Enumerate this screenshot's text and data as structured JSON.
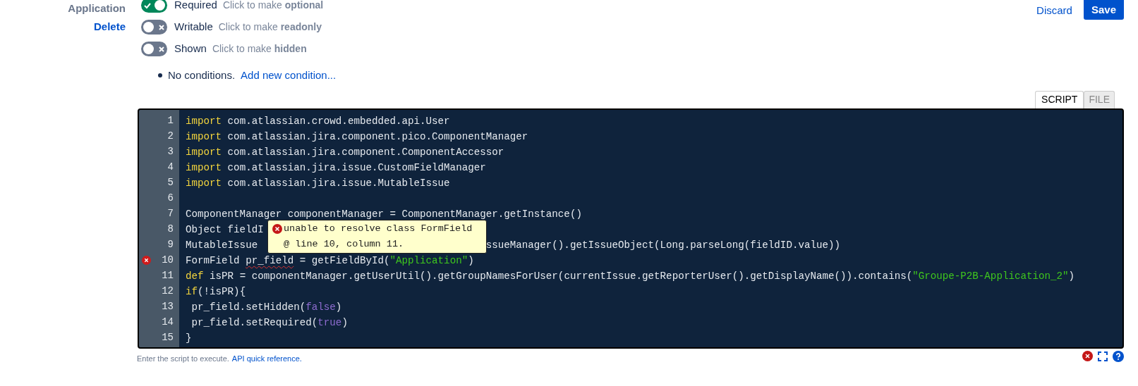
{
  "field": {
    "name": "Application",
    "delete_link": "Delete"
  },
  "toggles": [
    {
      "label": "Required",
      "hint": "Click to make **optional**",
      "on": true
    },
    {
      "label": "Writable",
      "hint": "Click to make **readonly**",
      "on": false
    },
    {
      "label": "Shown",
      "hint": "Click to make **hidden**",
      "on": false
    }
  ],
  "conditions": {
    "text": "No conditions.",
    "link": "Add new condition..."
  },
  "actions": {
    "discard": "Discard",
    "save": "Save"
  },
  "tabs": [
    {
      "label": "SCRIPT",
      "selected": true
    },
    {
      "label": "FILE",
      "selected": false
    }
  ],
  "editor": {
    "lines": [
      {
        "number": "1",
        "error": false,
        "fragments": [
          [
            {
              "kind": "keyword",
              "text": "import"
            },
            {
              "kind": "plain",
              "text": " com.atlassian.crowd.embedded.api.User"
            }
          ]
        ]
      },
      {
        "number": "2",
        "error": false,
        "fragments": [
          [
            {
              "kind": "keyword",
              "text": "import"
            },
            {
              "kind": "plain",
              "text": " com.atlassian.jira.component.pico.ComponentManager"
            }
          ]
        ]
      },
      {
        "number": "3",
        "error": false,
        "fragments": [
          [
            {
              "kind": "keyword",
              "text": "import"
            },
            {
              "kind": "plain",
              "text": " com.atlassian.jira.component.ComponentAccessor"
            }
          ]
        ]
      },
      {
        "number": "4",
        "error": false,
        "fragments": [
          [
            {
              "kind": "keyword",
              "text": "import"
            },
            {
              "kind": "plain",
              "text": " com.atlassian.jira.issue.CustomFieldManager"
            }
          ]
        ]
      },
      {
        "number": "5",
        "error": false,
        "fragments": [
          [
            {
              "kind": "keyword",
              "text": "import"
            },
            {
              "kind": "plain",
              "text": " com.atlassian.jira.issue.MutableIssue"
            }
          ]
        ]
      },
      {
        "number": "6",
        "error": false
      },
      {
        "number": "7",
        "error": false,
        "fragments": [
          [
            {
              "kind": "plain",
              "text": "ComponentManager componentManager = ComponentManager.getInstance()"
            }
          ]
        ]
      },
      {
        "number": "8",
        "error": false,
        "fragments": [
          [
            {
              "kind": "plain",
              "text": "Object fieldI"
            }
          ]
        ]
      },
      {
        "number": "9",
        "error": false,
        "fragments": [
          [
            {
              "kind": "plain",
              "text": "MutableIssue"
            }
          ],
          [
            {
              "kind": "plain",
              "text": "ssueManager().getIssueObject(Long.parseLong(fieldID.value))"
            }
          ]
        ]
      },
      {
        "number": "10",
        "error": true,
        "fragments": [
          [
            {
              "kind": "plain",
              "text": "FormField "
            },
            {
              "kind": "error",
              "text": "pr_field"
            },
            {
              "kind": "plain",
              "text": " = getFieldById("
            },
            {
              "kind": "string",
              "text": "\"Application\""
            },
            {
              "kind": "plain",
              "text": ")"
            }
          ]
        ]
      },
      {
        "number": "11",
        "error": false,
        "fragments": [
          [
            {
              "kind": "keyword",
              "text": "def"
            },
            {
              "kind": "plain",
              "text": " isPR = componentManager.getUserUtil().getGroupNamesForUser(currentIssue.getReporterUser().getDisplayName()).contains("
            },
            {
              "kind": "string",
              "text": "\"Groupe-P2B-Application_2\""
            },
            {
              "kind": "plain",
              "text": ")"
            }
          ]
        ]
      },
      {
        "number": "12",
        "error": false,
        "fragments": [
          [
            {
              "kind": "keyword",
              "text": "if"
            },
            {
              "kind": "plain",
              "text": "(!isPR){"
            }
          ]
        ]
      },
      {
        "number": "13",
        "error": false,
        "fragments": [
          [
            {
              "kind": "plain",
              "text": " pr_field.setHidden("
            },
            {
              "kind": "literal",
              "text": "false"
            },
            {
              "kind": "plain",
              "text": ")"
            }
          ]
        ]
      },
      {
        "number": "14",
        "error": false,
        "fragments": [
          [
            {
              "kind": "plain",
              "text": " pr_field.setRequired("
            },
            {
              "kind": "literal",
              "text": "true"
            },
            {
              "kind": "plain",
              "text": ")"
            }
          ]
        ]
      },
      {
        "number": "15",
        "error": false,
        "fragments": [
          [
            {
              "kind": "plain",
              "text": "}"
            }
          ]
        ]
      }
    ],
    "tooltip": {
      "message": "unable to resolve class FormField",
      "location": "@ line 10, column 11."
    }
  },
  "footer": {
    "text": "Enter the script to execute.",
    "link": "API quick reference."
  }
}
